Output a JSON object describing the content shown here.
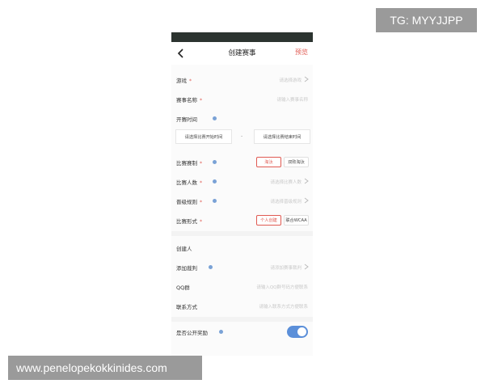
{
  "watermarks": {
    "top": "TG: MYYJJPP",
    "bottom": "www.penelopekokkinides.com"
  },
  "nav": {
    "title": "创建赛事",
    "preview": "预览",
    "back_icon": "chevron-left-icon"
  },
  "form": {
    "game": {
      "label": "游戏",
      "required": "*",
      "placeholder": "请选择游戏"
    },
    "name": {
      "label": "赛事名称",
      "required": "*",
      "placeholder": "请输入赛事名称"
    },
    "time": {
      "label": "开赛时间",
      "start_button": "请选择比赛开始时间",
      "separator": "-",
      "end_button": "请选择比赛结束时间"
    },
    "format": {
      "label": "比赛赛制",
      "required": "*",
      "options": [
        "淘汰",
        "双败淘汰"
      ],
      "selected": "淘汰"
    },
    "players": {
      "label": "比赛人数",
      "required": "*",
      "placeholder": "请选择比赛人数"
    },
    "advance": {
      "label": "晋级规则",
      "required": "*",
      "placeholder": "请选择晋级规则"
    },
    "form_type": {
      "label": "比赛形式",
      "required": "*",
      "options": [
        "个人创建",
        "联合WCAA"
      ],
      "selected": "个人创建"
    },
    "creator": {
      "label": "创建人"
    },
    "referee": {
      "label": "添加裁判",
      "placeholder": "请添加赛事裁判"
    },
    "qq": {
      "label": "QQ群",
      "placeholder": "请输入QQ群号码方便联系"
    },
    "contact": {
      "label": "联系方式",
      "placeholder": "请输入联系方式方便联系"
    },
    "public_reward": {
      "label": "是否公开奖励",
      "enabled": true
    }
  },
  "colors": {
    "accent": "#e05a52",
    "toggle": "#5b8fd9",
    "info": "#7aa2d6",
    "statusbar": "#2c3430"
  }
}
